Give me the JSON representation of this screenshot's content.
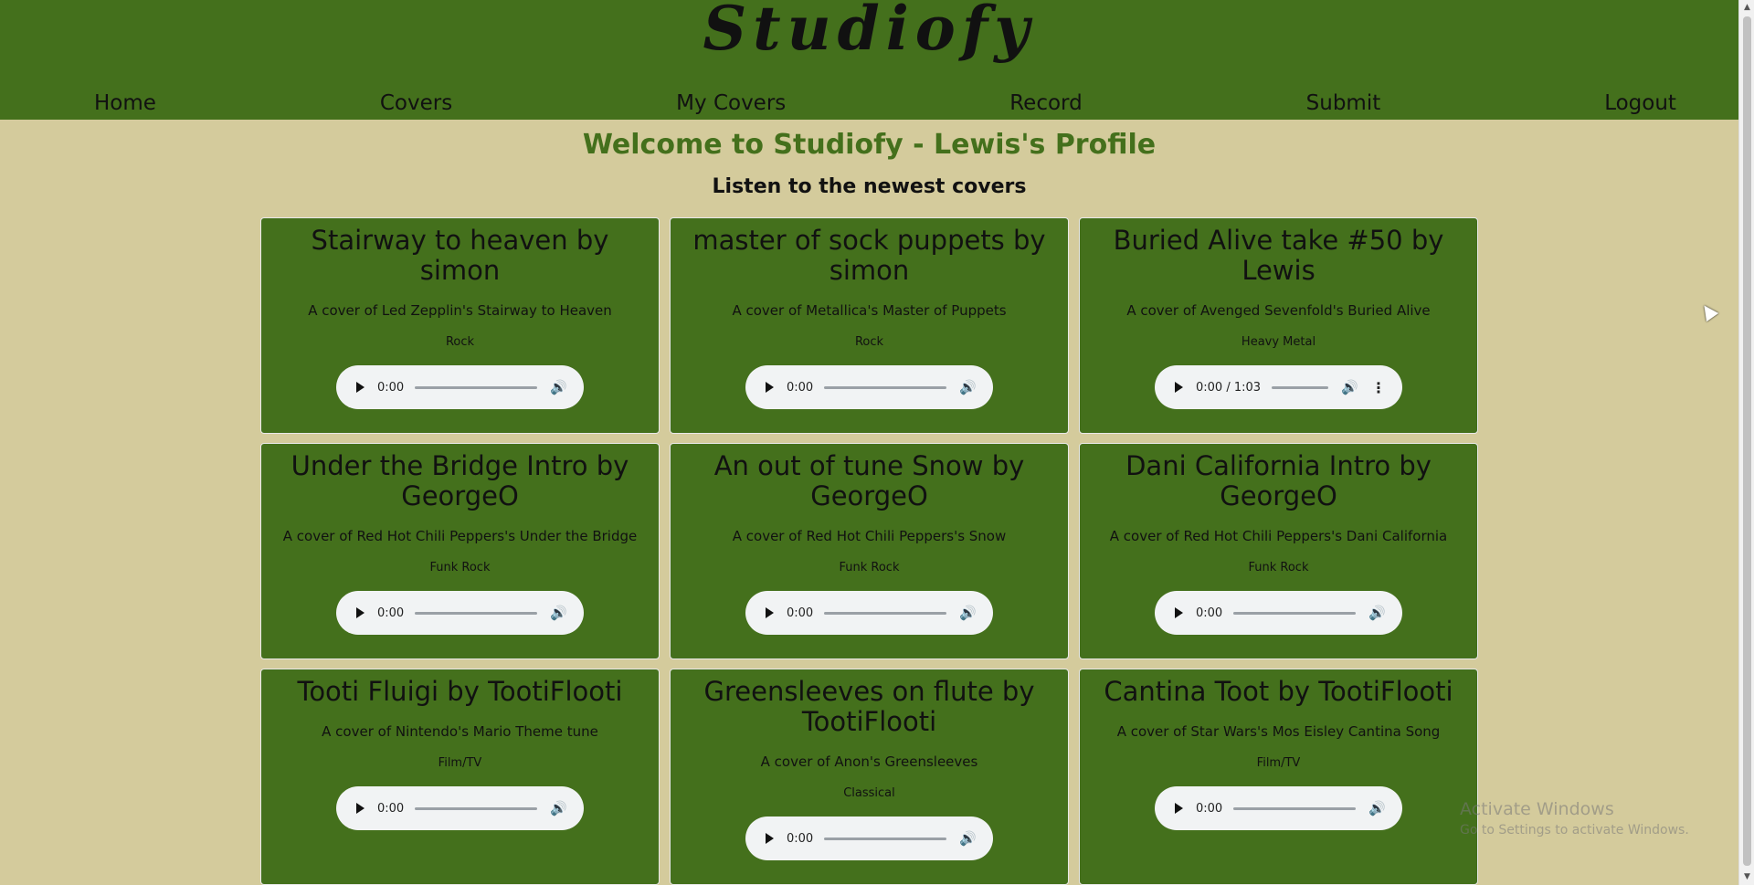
{
  "brand": "Studiofy",
  "nav": [
    "Home",
    "Covers",
    "My Covers",
    "Record",
    "Submit",
    "Logout"
  ],
  "welcome": "Welcome to Studiofy - Lewis's Profile",
  "subtitle": "Listen to the newest covers",
  "cards": [
    {
      "title": "Stairway to heaven by simon",
      "desc": "A cover of Led Zepplin's Stairway to Heaven",
      "genre": "Rock",
      "time": "0:00"
    },
    {
      "title": "master of sock puppets by simon",
      "desc": "A cover of Metallica's Master of Puppets",
      "genre": "Rock",
      "time": "0:00"
    },
    {
      "title": "Buried Alive take #50 by Lewis",
      "desc": "A cover of Avenged Sevenfold's Buried Alive",
      "genre": "Heavy Metal",
      "time": "0:00 / 1:03"
    },
    {
      "title": "Under the Bridge Intro by GeorgeO",
      "desc": "A cover of Red Hot Chili Peppers's Under the Bridge",
      "genre": "Funk Rock",
      "time": "0:00"
    },
    {
      "title": "An out of tune Snow by GeorgeO",
      "desc": "A cover of Red Hot Chili Peppers's Snow",
      "genre": "Funk Rock",
      "time": "0:00"
    },
    {
      "title": "Dani California Intro by GeorgeO",
      "desc": "A cover of Red Hot Chili Peppers's Dani California",
      "genre": "Funk Rock",
      "time": "0:00"
    },
    {
      "title": "Tooti Fluigi by TootiFlooti",
      "desc": "A cover of Nintendo's Mario Theme tune",
      "genre": "Film/TV",
      "time": "0:00"
    },
    {
      "title": "Greensleeves on flute by TootiFlooti",
      "desc": "A cover of Anon's Greensleeves",
      "genre": "Classical",
      "time": "0:00"
    },
    {
      "title": "Cantina Toot by TootiFlooti",
      "desc": "A cover of Star Wars's Mos Eisley Cantina Song",
      "genre": "Film/TV",
      "time": "0:00"
    }
  ],
  "watermark": {
    "line1": "Activate Windows",
    "line2": "Go to Settings to activate Windows."
  },
  "colors": {
    "header": "#44701c",
    "background": "#d4cb9c",
    "card": "#44701c",
    "welcome_text": "#44701c"
  }
}
